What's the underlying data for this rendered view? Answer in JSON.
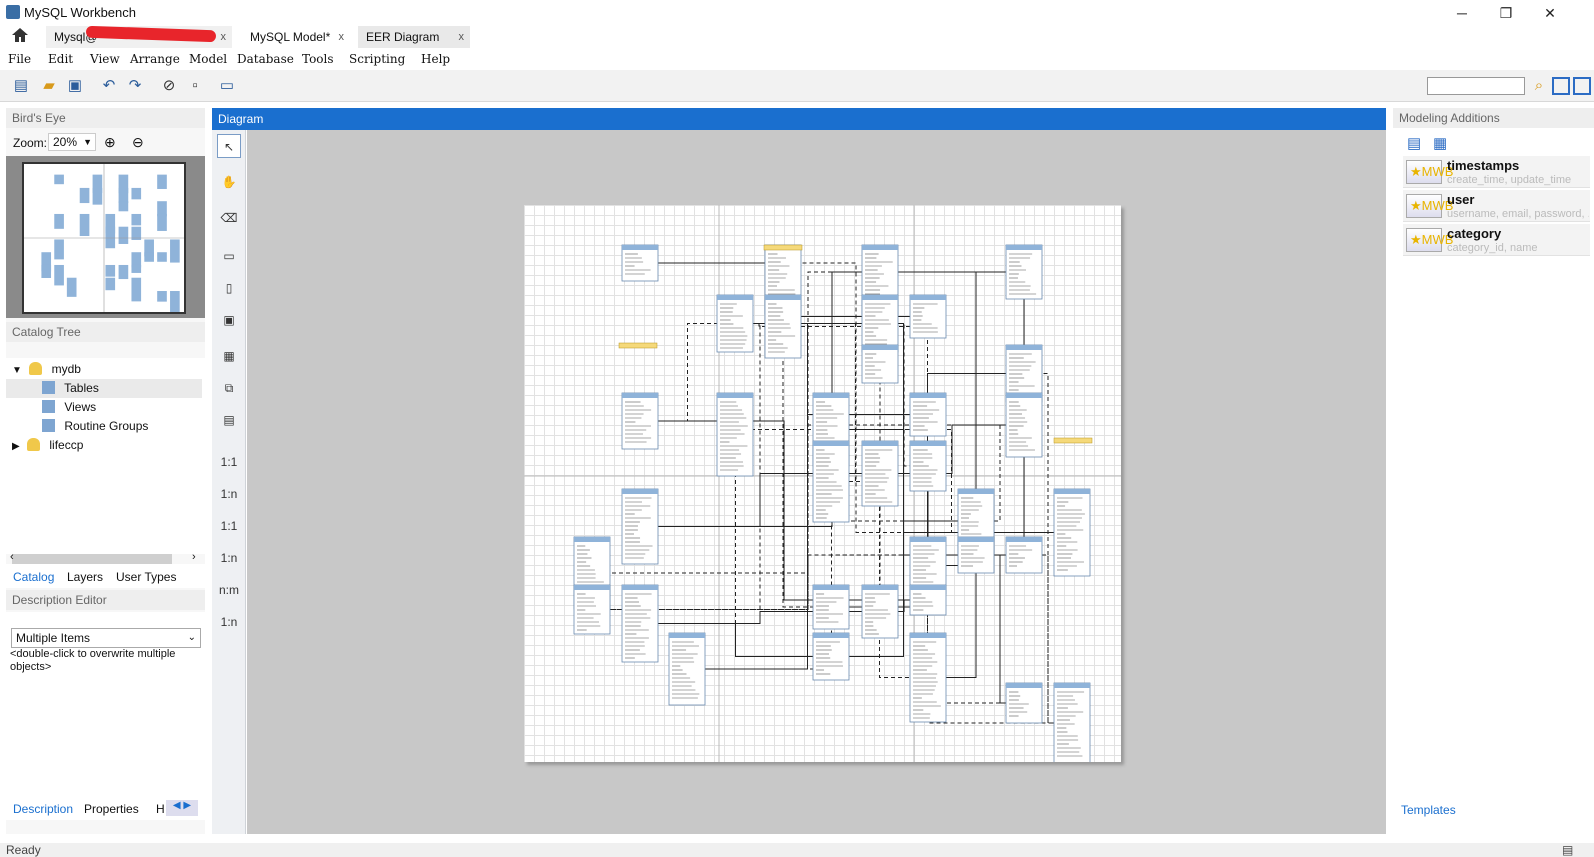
{
  "window": {
    "title": "MySQL Workbench",
    "minimize": "─",
    "maximize": "❐",
    "close": "✕"
  },
  "tabs": [
    {
      "label": "Mysql@"
    },
    {
      "label": "MySQL Model*"
    },
    {
      "label": "EER Diagram"
    }
  ],
  "tab_close": "x",
  "menu": [
    "File",
    "Edit",
    "View",
    "Arrange",
    "Model",
    "Database",
    "Tools",
    "Scripting",
    "Help"
  ],
  "left": {
    "birds_eye": "Bird's Eye",
    "zoom_label": "Zoom:",
    "zoom_value": "20%",
    "catalog_tree": "Catalog Tree",
    "tree": [
      {
        "label": "mydb"
      },
      {
        "label": "Tables"
      },
      {
        "label": "Views"
      },
      {
        "label": "Routine Groups"
      },
      {
        "label": "lifeccp"
      }
    ],
    "bottom_tabs": [
      "Catalog",
      "Layers",
      "User Types"
    ],
    "description_editor": "Description Editor",
    "desc_select": "Multiple Items",
    "desc_text": "<double-click to overwrite multiple objects>",
    "lower_tabs": [
      "Description",
      "Properties",
      "H"
    ]
  },
  "diagram": {
    "header": "Diagram",
    "palette_labels": [
      "1:1",
      "1:n",
      "1:1",
      "1:n",
      "n:m",
      "1:n"
    ]
  },
  "right": {
    "title": "Modeling Additions",
    "additions": [
      {
        "name": "timestamps",
        "desc": "create_time, update_time",
        "icon": "★MWB"
      },
      {
        "name": "user",
        "desc": "username, email, password, ...",
        "icon": "★MWB"
      },
      {
        "name": "category",
        "desc": "category_id, name",
        "icon": "★MWB"
      }
    ],
    "templates": "Templates"
  },
  "status": "Ready",
  "colors": {
    "accent": "#1a6fcf",
    "table": "#8fb3d9",
    "note": "#f5d97a"
  }
}
